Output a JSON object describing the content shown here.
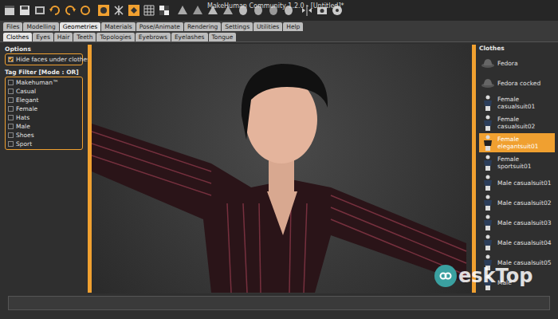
{
  "window": {
    "title": "MakeHuman Community 1.2.0 - [Untitled]*"
  },
  "tabs": [
    {
      "label": "Files",
      "selected": false
    },
    {
      "label": "Modelling",
      "selected": false
    },
    {
      "label": "Geometries",
      "selected": true
    },
    {
      "label": "Materials",
      "selected": false
    },
    {
      "label": "Pose/Animate",
      "selected": false
    },
    {
      "label": "Rendering",
      "selected": false
    },
    {
      "label": "Settings",
      "selected": false
    },
    {
      "label": "Utilities",
      "selected": false
    },
    {
      "label": "Help",
      "selected": false
    }
  ],
  "subtabs": [
    {
      "label": "Clothes",
      "selected": true
    },
    {
      "label": "Eyes",
      "selected": false
    },
    {
      "label": "Hair",
      "selected": false
    },
    {
      "label": "Teeth",
      "selected": false
    },
    {
      "label": "Topologies",
      "selected": false
    },
    {
      "label": "Eyebrows",
      "selected": false
    },
    {
      "label": "Eyelashes",
      "selected": false
    },
    {
      "label": "Tongue",
      "selected": false
    }
  ],
  "options": {
    "title": "Options",
    "items": [
      {
        "label": "Hide faces under clothes",
        "checked": true
      }
    ]
  },
  "tag_filter": {
    "title": "Tag Filter [Mode : OR]",
    "items": [
      {
        "label": "Makehuman™",
        "checked": false
      },
      {
        "label": "Casual",
        "checked": false
      },
      {
        "label": "Elegant",
        "checked": false
      },
      {
        "label": "Female",
        "checked": false
      },
      {
        "label": "Hats",
        "checked": false
      },
      {
        "label": "Male",
        "checked": false
      },
      {
        "label": "Shoes",
        "checked": false
      },
      {
        "label": "Sport",
        "checked": false
      }
    ]
  },
  "clothes": {
    "title": "Clothes",
    "items": [
      {
        "label": "Fedora",
        "selected": false,
        "kind": "hat"
      },
      {
        "label": "Fedora cocked",
        "selected": false,
        "kind": "hat"
      },
      {
        "label": "Female casualsuit01",
        "selected": false,
        "kind": "outfit"
      },
      {
        "label": "Female casualsuit02",
        "selected": false,
        "kind": "outfit"
      },
      {
        "label": "Female elegantsuit01",
        "selected": true,
        "kind": "outfit"
      },
      {
        "label": "Female sportsuit01",
        "selected": false,
        "kind": "outfit"
      },
      {
        "label": "Male casualsuit01",
        "selected": false,
        "kind": "outfit"
      },
      {
        "label": "Male casualsuit02",
        "selected": false,
        "kind": "outfit"
      },
      {
        "label": "Male casualsuit03",
        "selected": false,
        "kind": "outfit"
      },
      {
        "label": "Male casualsuit04",
        "selected": false,
        "kind": "outfit"
      },
      {
        "label": "Male casualsuit05",
        "selected": false,
        "kind": "outfit"
      },
      {
        "label": "Male",
        "selected": false,
        "kind": "outfit"
      }
    ]
  },
  "watermark": {
    "text": "eskTop"
  }
}
